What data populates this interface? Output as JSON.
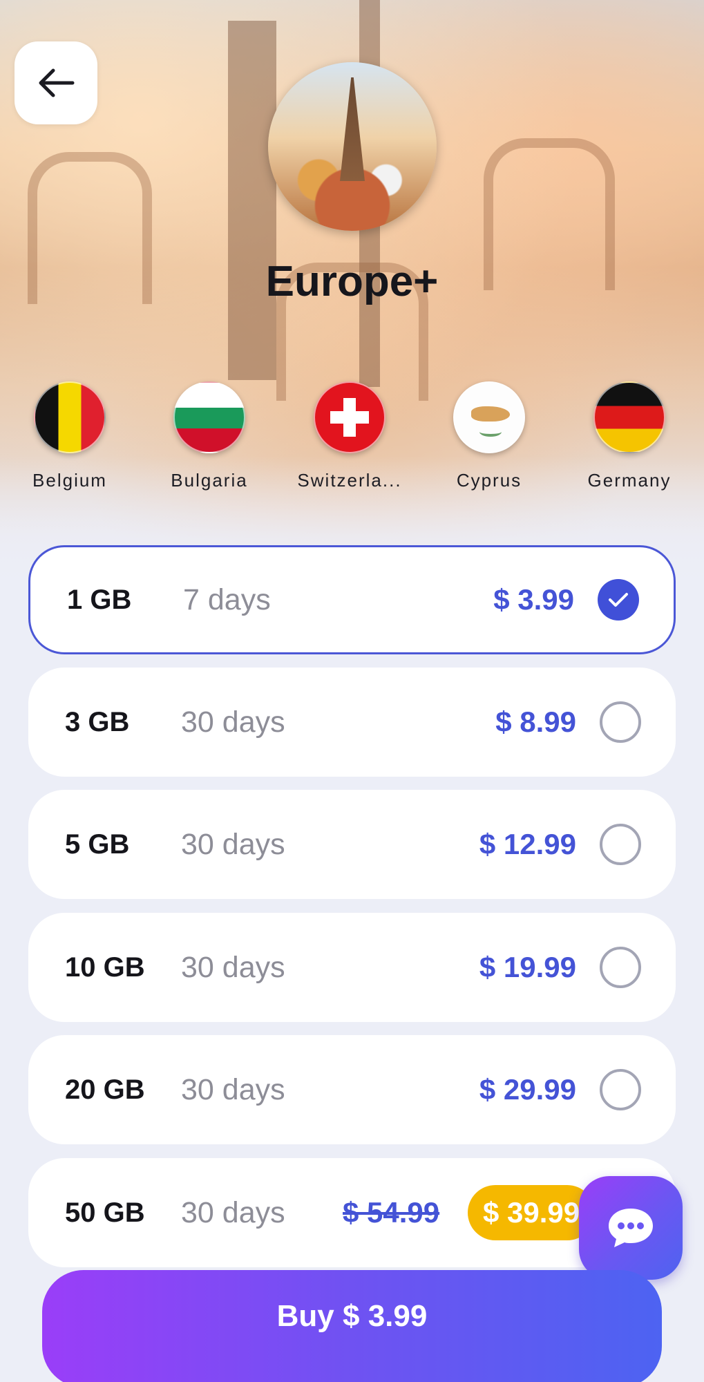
{
  "header": {
    "back_icon": "arrow-left-icon",
    "title": "Europe+"
  },
  "countries": [
    {
      "name": "Belgium"
    },
    {
      "name": "Bulgaria"
    },
    {
      "name": "Switzerla..."
    },
    {
      "name": "Cyprus"
    },
    {
      "name": "Germany"
    }
  ],
  "plans": [
    {
      "data": "1 GB",
      "duration": "7 days",
      "price": "$ 3.99",
      "selected": true
    },
    {
      "data": "3 GB",
      "duration": "30 days",
      "price": "$ 8.99",
      "selected": false
    },
    {
      "data": "5 GB",
      "duration": "30 days",
      "price": "$ 12.99",
      "selected": false
    },
    {
      "data": "10 GB",
      "duration": "30 days",
      "price": "$ 19.99",
      "selected": false
    },
    {
      "data": "20 GB",
      "duration": "30 days",
      "price": "$ 29.99",
      "selected": false
    },
    {
      "data": "50 GB",
      "duration": "30 days",
      "old_price": "$ 54.99",
      "price": "$ 39.99",
      "selected": false
    }
  ],
  "buy_button": {
    "label": "Buy $ 3.99"
  },
  "chat_icon": "chat-bubble-icon",
  "colors": {
    "accent": "#4453d6",
    "badge": "#f5b800",
    "gradient_start": "#9a3ef8",
    "gradient_end": "#4d63f2"
  }
}
